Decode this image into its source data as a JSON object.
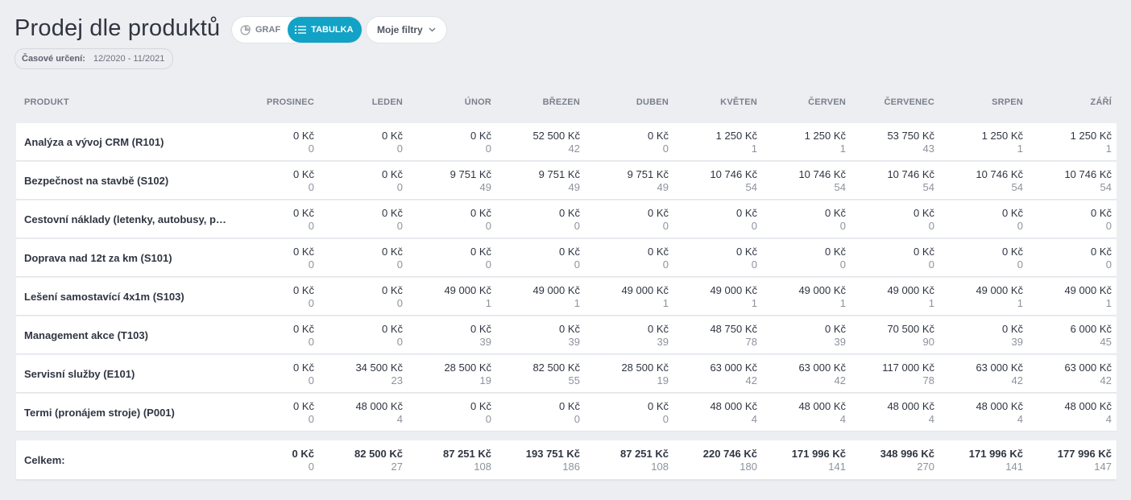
{
  "page": {
    "title": "Prodej dle produktů",
    "view_toggle": {
      "graf_label": "GRAF",
      "tabulka_label": "TABULKA",
      "active": "TABULKA"
    },
    "filters_label": "Moje filtry",
    "period_label": "Časové určení:",
    "period_value": "12/2020 - 11/2021"
  },
  "table": {
    "product_header": "PRODUKT",
    "months": [
      "PROSINEC",
      "LEDEN",
      "ÚNOR",
      "BŘEZEN",
      "DUBEN",
      "KVĚTEN",
      "ČERVEN",
      "ČERVENEC",
      "SRPEN",
      "ZÁŘÍ"
    ],
    "rows": [
      {
        "name": "Analýza a vývoj CRM (R101)",
        "cells": [
          [
            "0 Kč",
            "0"
          ],
          [
            "0 Kč",
            "0"
          ],
          [
            "0 Kč",
            "0"
          ],
          [
            "52 500 Kč",
            "42"
          ],
          [
            "0 Kč",
            "0"
          ],
          [
            "1 250 Kč",
            "1"
          ],
          [
            "1 250 Kč",
            "1"
          ],
          [
            "53 750 Kč",
            "43"
          ],
          [
            "1 250 Kč",
            "1"
          ],
          [
            "1 250 Kč",
            "1"
          ]
        ]
      },
      {
        "name": "Bezpečnost na stavbě (S102)",
        "cells": [
          [
            "0 Kč",
            "0"
          ],
          [
            "0 Kč",
            "0"
          ],
          [
            "9 751 Kč",
            "49"
          ],
          [
            "9 751 Kč",
            "49"
          ],
          [
            "9 751 Kč",
            "49"
          ],
          [
            "10 746 Kč",
            "54"
          ],
          [
            "10 746 Kč",
            "54"
          ],
          [
            "10 746 Kč",
            "54"
          ],
          [
            "10 746 Kč",
            "54"
          ],
          [
            "10 746 Kč",
            "54"
          ]
        ]
      },
      {
        "name": "Cestovní náklady (letenky, autobusy, přep…",
        "cells": [
          [
            "0 Kč",
            "0"
          ],
          [
            "0 Kč",
            "0"
          ],
          [
            "0 Kč",
            "0"
          ],
          [
            "0 Kč",
            "0"
          ],
          [
            "0 Kč",
            "0"
          ],
          [
            "0 Kč",
            "0"
          ],
          [
            "0 Kč",
            "0"
          ],
          [
            "0 Kč",
            "0"
          ],
          [
            "0 Kč",
            "0"
          ],
          [
            "0 Kč",
            "0"
          ]
        ]
      },
      {
        "name": "Doprava nad 12t za km (S101)",
        "cells": [
          [
            "0 Kč",
            "0"
          ],
          [
            "0 Kč",
            "0"
          ],
          [
            "0 Kč",
            "0"
          ],
          [
            "0 Kč",
            "0"
          ],
          [
            "0 Kč",
            "0"
          ],
          [
            "0 Kč",
            "0"
          ],
          [
            "0 Kč",
            "0"
          ],
          [
            "0 Kč",
            "0"
          ],
          [
            "0 Kč",
            "0"
          ],
          [
            "0 Kč",
            "0"
          ]
        ]
      },
      {
        "name": "Lešení samostavící 4x1m (S103)",
        "cells": [
          [
            "0 Kč",
            "0"
          ],
          [
            "0 Kč",
            "0"
          ],
          [
            "49 000 Kč",
            "1"
          ],
          [
            "49 000 Kč",
            "1"
          ],
          [
            "49 000 Kč",
            "1"
          ],
          [
            "49 000 Kč",
            "1"
          ],
          [
            "49 000 Kč",
            "1"
          ],
          [
            "49 000 Kč",
            "1"
          ],
          [
            "49 000 Kč",
            "1"
          ],
          [
            "49 000 Kč",
            "1"
          ]
        ]
      },
      {
        "name": "Management akce (T103)",
        "cells": [
          [
            "0 Kč",
            "0"
          ],
          [
            "0 Kč",
            "0"
          ],
          [
            "0 Kč",
            "39"
          ],
          [
            "0 Kč",
            "39"
          ],
          [
            "0 Kč",
            "39"
          ],
          [
            "48 750 Kč",
            "78"
          ],
          [
            "0 Kč",
            "39"
          ],
          [
            "70 500 Kč",
            "90"
          ],
          [
            "0 Kč",
            "39"
          ],
          [
            "6 000 Kč",
            "45"
          ]
        ]
      },
      {
        "name": "Servisní služby (E101)",
        "cells": [
          [
            "0 Kč",
            "0"
          ],
          [
            "34 500 Kč",
            "23"
          ],
          [
            "28 500 Kč",
            "19"
          ],
          [
            "82 500 Kč",
            "55"
          ],
          [
            "28 500 Kč",
            "19"
          ],
          [
            "63 000 Kč",
            "42"
          ],
          [
            "63 000 Kč",
            "42"
          ],
          [
            "117 000 Kč",
            "78"
          ],
          [
            "63 000 Kč",
            "42"
          ],
          [
            "63 000 Kč",
            "42"
          ]
        ]
      },
      {
        "name": "Termi (pronájem stroje) (P001)",
        "cells": [
          [
            "0 Kč",
            "0"
          ],
          [
            "48 000 Kč",
            "4"
          ],
          [
            "0 Kč",
            "0"
          ],
          [
            "0 Kč",
            "0"
          ],
          [
            "0 Kč",
            "0"
          ],
          [
            "48 000 Kč",
            "4"
          ],
          [
            "48 000 Kč",
            "4"
          ],
          [
            "48 000 Kč",
            "4"
          ],
          [
            "48 000 Kč",
            "4"
          ],
          [
            "48 000 Kč",
            "4"
          ]
        ]
      }
    ],
    "total": {
      "name": "Celkem:",
      "cells": [
        [
          "0 Kč",
          "0"
        ],
        [
          "82 500 Kč",
          "27"
        ],
        [
          "87 251 Kč",
          "108"
        ],
        [
          "193 751 Kč",
          "186"
        ],
        [
          "87 251 Kč",
          "108"
        ],
        [
          "220 746 Kč",
          "180"
        ],
        [
          "171 996 Kč",
          "141"
        ],
        [
          "348 996 Kč",
          "270"
        ],
        [
          "171 996 Kč",
          "141"
        ],
        [
          "177 996 Kč",
          "147"
        ]
      ]
    }
  },
  "colors": {
    "accent": "#12a2c6",
    "background": "#eceef2"
  },
  "icons": {
    "graf": "pie-chart-icon",
    "tabulka": "list-icon",
    "filters": "chevron-down-icon"
  }
}
